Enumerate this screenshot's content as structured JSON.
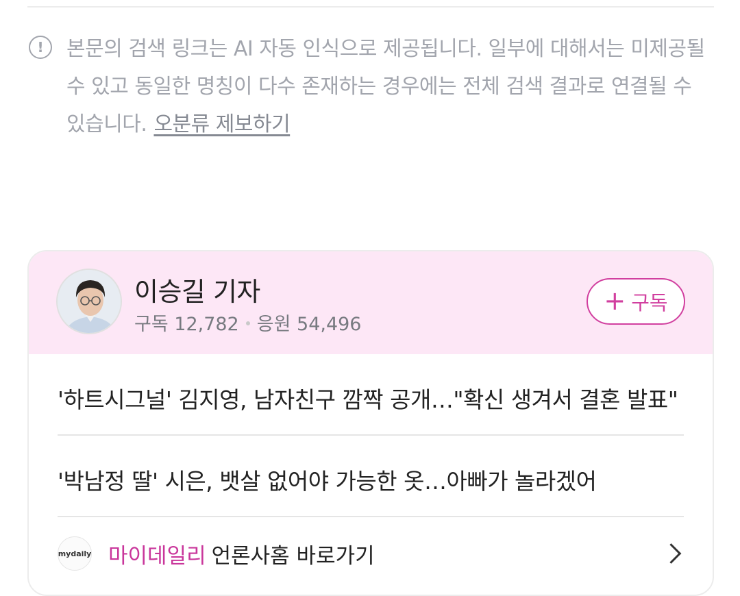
{
  "notice": {
    "text": "본문의 검색 링크는 AI 자동 인식으로 제공됩니다. 일부에 대해서는 미제공될 수 있고 동일한 명칭이 다수 존재하는 경우에는 전체 검색 결과로 연결될 수 있습니다.",
    "link_label": "오분류 제보하기",
    "icon": "exclamation-circle-icon"
  },
  "reporter": {
    "name": "이승길 기자",
    "subscribers_label": "구독 12,782",
    "cheers_label": "응원 54,496",
    "subscribe_button_label": "구독",
    "subscribe_icon": "plus-icon"
  },
  "articles": [
    {
      "title": "'하트시그널' 김지영, 남자친구 깜짝 공개…\"확신 생겨서 결혼 발표\""
    },
    {
      "title": "'박남정 딸' 시은, 뱃살 없어야 가능한 옷…아빠가 놀라겠어"
    }
  ],
  "press": {
    "logo_text": "mydaily",
    "name": "마이데일리",
    "suffix": "언론사홈 바로가기",
    "icon": "chevron-right-icon"
  },
  "colors": {
    "accent": "#d13f9f",
    "header_bg": "#fde7f6",
    "notice_text": "#a2a5ad"
  }
}
